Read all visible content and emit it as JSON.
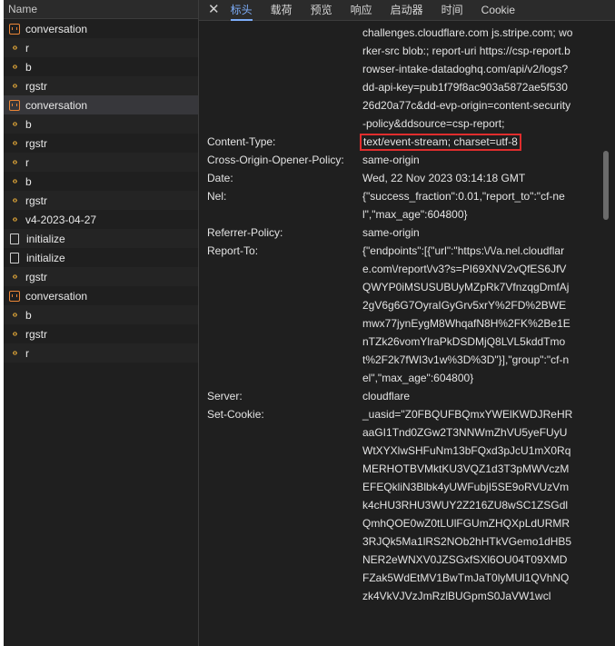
{
  "requests_header": "Name",
  "requests": [
    {
      "type": "xhr",
      "name": "conversation",
      "selected": false
    },
    {
      "type": "script",
      "name": "r",
      "selected": false
    },
    {
      "type": "script",
      "name": "b",
      "selected": false
    },
    {
      "type": "script",
      "name": "rgstr",
      "selected": false
    },
    {
      "type": "xhr",
      "name": "conversation",
      "selected": true
    },
    {
      "type": "script",
      "name": "b",
      "selected": false
    },
    {
      "type": "script",
      "name": "rgstr",
      "selected": false
    },
    {
      "type": "script",
      "name": "r",
      "selected": false
    },
    {
      "type": "script",
      "name": "b",
      "selected": false
    },
    {
      "type": "script",
      "name": "rgstr",
      "selected": false
    },
    {
      "type": "script",
      "name": "v4-2023-04-27",
      "selected": false
    },
    {
      "type": "doc",
      "name": "initialize",
      "selected": false
    },
    {
      "type": "doc",
      "name": "initialize",
      "selected": false
    },
    {
      "type": "script",
      "name": "rgstr",
      "selected": false
    },
    {
      "type": "xhr",
      "name": "conversation",
      "selected": false
    },
    {
      "type": "script",
      "name": "b",
      "selected": false
    },
    {
      "type": "script",
      "name": "rgstr",
      "selected": false
    },
    {
      "type": "script",
      "name": "r",
      "selected": false
    }
  ],
  "tabs": {
    "close": "✕",
    "items": [
      "标头",
      "载荷",
      "预览",
      "响应",
      "启动器",
      "时间",
      "Cookie"
    ],
    "active_index": 0
  },
  "headers": [
    {
      "name": "",
      "value": "challenges.cloudflare.com js.stripe.com; worker-src blob:; report-uri https://csp-report.browser-intake-datadoghq.com/api/v2/logs?dd-api-key=pub1f79f8ac903a5872ae5f53026d20a77c&dd-evp-origin=content-security-policy&ddsource=csp-report;",
      "highlight": false
    },
    {
      "name": "Content-Type:",
      "value": "text/event-stream; charset=utf-8",
      "highlight": true
    },
    {
      "name": "Cross-Origin-Opener-Policy:",
      "value": "same-origin",
      "highlight": false
    },
    {
      "name": "Date:",
      "value": "Wed, 22 Nov 2023 03:14:18 GMT",
      "highlight": false
    },
    {
      "name": "Nel:",
      "value": "{\"success_fraction\":0.01,\"report_to\":\"cf-nel\",\"max_age\":604800}",
      "highlight": false
    },
    {
      "name": "Referrer-Policy:",
      "value": "same-origin",
      "highlight": false
    },
    {
      "name": "Report-To:",
      "value": "{\"endpoints\":[{\"url\":\"https:\\/\\/a.nel.cloudflare.com\\/report\\/v3?s=PI69XNV2vQfES6JfVQWYP0iMSUSUBUyMZpRk7VfnzqgDmfAj2gV6g6G7OyraIGyGrv5xrY%2FD%2BWEmwx77jynEygM8WhqafN8H%2FK%2Be1EnTZk26vomYlraPkDSDMjQ8LVL5kddTmot%2F2k7fWI3v1w%3D%3D\"}],\"group\":\"cf-nel\",\"max_age\":604800}",
      "highlight": false
    },
    {
      "name": "Server:",
      "value": "cloudflare",
      "highlight": false
    },
    {
      "name": "Set-Cookie:",
      "value": "_uasid=\"Z0FBQUFBQmxYWElKWDJReHRaaGI1Tnd0ZGw2T3NNWmZhVU5yeFUyUWtXYXlwSHFuNm13bFQxd3pJcU1mX0RqMERHOTBVMktKU3VQZ1d3T3pMWVczMEFEQkliN3Blbk4yUWFubjI5SE9oRVUzVmk4cHU3RHU3WUY2Z216ZU8wSC1ZSGdlQmhQOE0wZ0tLUlFGUmZHQXpLdURMR3RJQk5Ma1lRS2NOb2hHTkVGemo1dHB5NER2eWNXV0JZSGxfSXl6OU04T09XMDFZak5WdEtMV1BwTmJaT0lyMUl1QVhNQzk4VkVJVzJmRzlBUGpmS0JaVW1wcl",
      "highlight": false
    }
  ]
}
